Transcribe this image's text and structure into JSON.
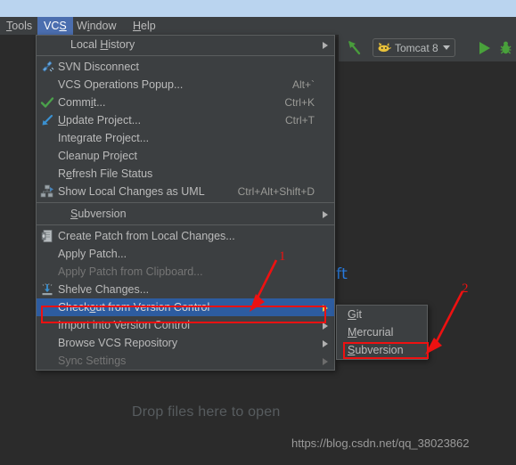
{
  "menubar": {
    "items": [
      {
        "label": "Tools",
        "mnemonic": "T",
        "active": false
      },
      {
        "label": "VCS",
        "mnemonic": "S",
        "active": true
      },
      {
        "label": "Window",
        "mnemonic": "i",
        "active": false
      },
      {
        "label": "Help",
        "mnemonic": "H",
        "active": false
      }
    ]
  },
  "toolbar": {
    "run_config_label": "Tomcat 8",
    "cat_icon": "tomcat-cat-icon",
    "back_arrow_icon": "up-left-arrow-icon",
    "run_icon": "run-play-icon",
    "debug_icon": "debug-bug-icon"
  },
  "editor": {
    "shift_fragment": "hift",
    "drop_hint": "Drop files here to open"
  },
  "vcs_menu": {
    "items": [
      {
        "label": "Local History",
        "mnemonic": "H",
        "shortcut": "",
        "icon": "",
        "submenu": true,
        "disabled": false,
        "selected": false,
        "indent": true
      },
      {
        "separator": true
      },
      {
        "label": "SVN Disconnect",
        "mnemonic": "",
        "shortcut": "",
        "icon": "svn-disconnect-icon",
        "submenu": false,
        "disabled": false,
        "selected": false,
        "indent": false
      },
      {
        "label": "VCS Operations Popup...",
        "mnemonic": "",
        "shortcut": "Alt+`",
        "icon": "",
        "submenu": false,
        "disabled": false,
        "selected": false,
        "indent": false
      },
      {
        "label": "Commit...",
        "mnemonic": "i",
        "shortcut": "Ctrl+K",
        "icon": "commit-check-icon",
        "submenu": false,
        "disabled": false,
        "selected": false,
        "indent": false
      },
      {
        "label": "Update Project...",
        "mnemonic": "U",
        "shortcut": "Ctrl+T",
        "icon": "update-arrow-icon",
        "submenu": false,
        "disabled": false,
        "selected": false,
        "indent": false
      },
      {
        "label": "Integrate Project...",
        "mnemonic": "g",
        "shortcut": "",
        "icon": "",
        "submenu": false,
        "disabled": false,
        "selected": false,
        "indent": false
      },
      {
        "label": "Cleanup Project",
        "mnemonic": "",
        "shortcut": "",
        "icon": "",
        "submenu": false,
        "disabled": false,
        "selected": false,
        "indent": false
      },
      {
        "label": "Refresh File Status",
        "mnemonic": "e",
        "shortcut": "",
        "icon": "",
        "submenu": false,
        "disabled": false,
        "selected": false,
        "indent": false
      },
      {
        "label": "Show Local Changes as UML",
        "mnemonic": "",
        "shortcut": "Ctrl+Alt+Shift+D",
        "icon": "uml-diagram-icon",
        "submenu": false,
        "disabled": false,
        "selected": false,
        "indent": false
      },
      {
        "separator": true
      },
      {
        "label": "Subversion",
        "mnemonic": "S",
        "shortcut": "",
        "icon": "",
        "submenu": true,
        "disabled": false,
        "selected": false,
        "indent": true
      },
      {
        "separator": true
      },
      {
        "label": "Create Patch from Local Changes...",
        "mnemonic": "",
        "shortcut": "",
        "icon": "create-patch-icon",
        "submenu": false,
        "disabled": false,
        "selected": false,
        "indent": false
      },
      {
        "label": "Apply Patch...",
        "mnemonic": "",
        "shortcut": "",
        "icon": "",
        "submenu": false,
        "disabled": false,
        "selected": false,
        "indent": false
      },
      {
        "label": "Apply Patch from Clipboard...",
        "mnemonic": "",
        "shortcut": "",
        "icon": "",
        "submenu": false,
        "disabled": true,
        "selected": false,
        "indent": false
      },
      {
        "label": "Shelve Changes...",
        "mnemonic": "",
        "shortcut": "",
        "icon": "shelve-changes-icon",
        "submenu": false,
        "disabled": false,
        "selected": false,
        "indent": false
      },
      {
        "label": "Checkout from Version Control",
        "mnemonic": "o",
        "shortcut": "",
        "icon": "",
        "submenu": true,
        "disabled": false,
        "selected": true,
        "indent": false
      },
      {
        "label": "Import into Version Control",
        "mnemonic": "",
        "shortcut": "",
        "icon": "",
        "submenu": true,
        "disabled": false,
        "selected": false,
        "indent": false
      },
      {
        "label": "Browse VCS Repository",
        "mnemonic": "",
        "shortcut": "",
        "icon": "",
        "submenu": true,
        "disabled": false,
        "selected": false,
        "indent": false
      },
      {
        "label": "Sync Settings",
        "mnemonic": "",
        "shortcut": "",
        "icon": "",
        "submenu": true,
        "disabled": true,
        "selected": false,
        "indent": false
      }
    ]
  },
  "checkout_submenu": {
    "items": [
      {
        "label": "Git",
        "mnemonic": "G",
        "highlighted": false
      },
      {
        "label": "Mercurial",
        "mnemonic": "M",
        "highlighted": false
      },
      {
        "label": "Subversion",
        "mnemonic": "S",
        "highlighted": true
      }
    ]
  },
  "annotations": {
    "marker_1": "1",
    "marker_2": "2",
    "color": "#ee1111"
  },
  "watermark": {
    "text": "https://blog.csdn.net/qq_38023862"
  }
}
